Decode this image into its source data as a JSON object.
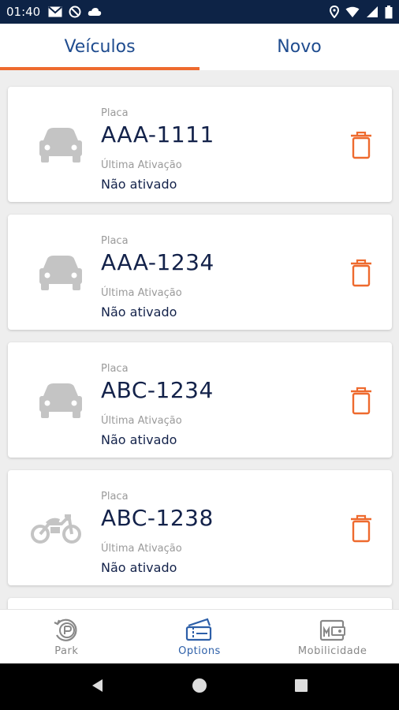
{
  "status_bar": {
    "time": "01:40"
  },
  "tabs": [
    {
      "label": "Veículos",
      "active": true
    },
    {
      "label": "Novo",
      "active": false
    }
  ],
  "vehicles": [
    {
      "placa_label": "Placa",
      "plate": "AAA-1111",
      "ultima_label": "Última Ativação",
      "ultima_value": "Não ativado",
      "icon": "car-icon"
    },
    {
      "placa_label": "Placa",
      "plate": "AAA-1234",
      "ultima_label": "Última Ativação",
      "ultima_value": "Não ativado",
      "icon": "car-icon"
    },
    {
      "placa_label": "Placa",
      "plate": "ABC-1234",
      "ultima_label": "Última Ativação",
      "ultima_value": "Não ativado",
      "icon": "car-icon"
    },
    {
      "placa_label": "Placa",
      "plate": "ABC-1238",
      "ultima_label": "Última Ativação",
      "ultima_value": "Não ativado",
      "icon": "motorcycle-icon"
    }
  ],
  "bottom_nav": [
    {
      "label": "Park",
      "icon": "park-icon",
      "active": false
    },
    {
      "label": "Options",
      "icon": "ticket-icon",
      "active": true
    },
    {
      "label": "Mobilicidade",
      "icon": "wallet-icon",
      "active": false
    }
  ],
  "colors": {
    "status_bar": "#0d2346",
    "accent": "#ee6a2e",
    "tab_text": "#1f4c8f",
    "plate_text": "#13224a",
    "nav_active": "#2d5fa8"
  }
}
